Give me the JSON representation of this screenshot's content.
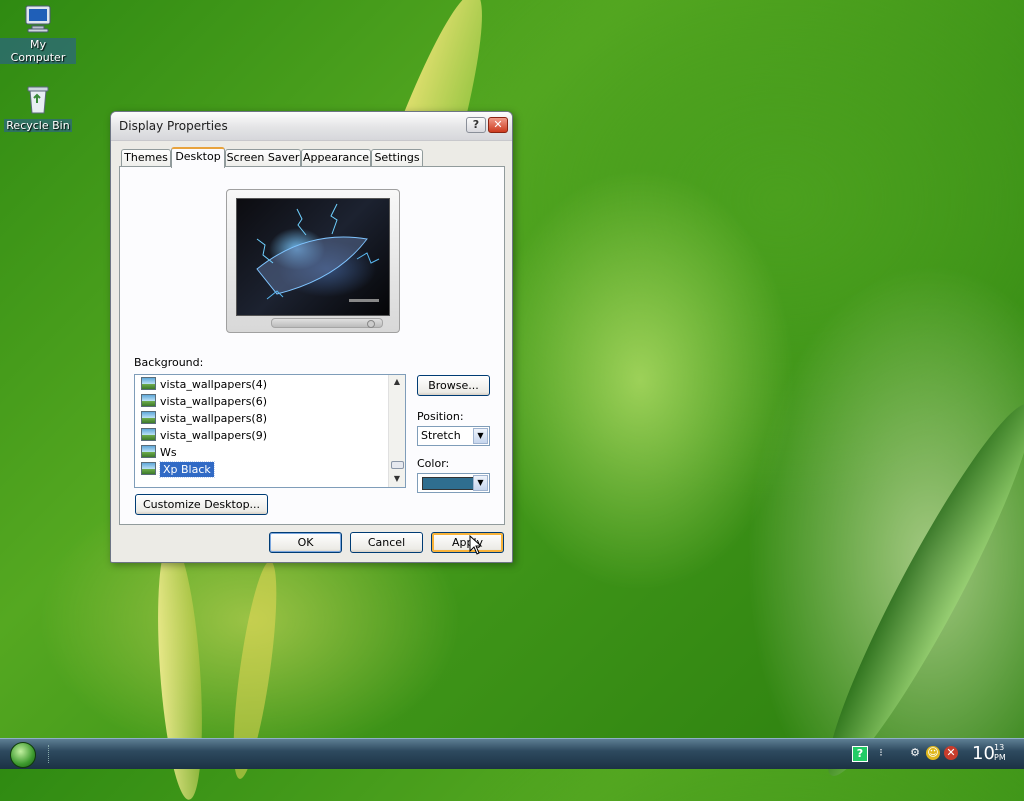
{
  "desktop": {
    "icons": [
      {
        "label": "My Computer"
      },
      {
        "label": "Recycle Bin"
      }
    ]
  },
  "dialog": {
    "title": "Display Properties",
    "help_glyph": "?",
    "close_glyph": "✕",
    "tabs": [
      "Themes",
      "Desktop",
      "Screen Saver",
      "Appearance",
      "Settings"
    ],
    "active_tab": "Desktop",
    "background_label": "Background:",
    "backgrounds": [
      {
        "name": "vista_wallpapers(4)"
      },
      {
        "name": "vista_wallpapers(6)"
      },
      {
        "name": "vista_wallpapers(8)"
      },
      {
        "name": "vista_wallpapers(9)"
      },
      {
        "name": "Ws"
      },
      {
        "name": "Xp Black",
        "selected": true
      }
    ],
    "browse_label": "Browse...",
    "position_label": "Position:",
    "position_value": "Stretch",
    "color_label": "Color:",
    "color_value": "#2f6e8f",
    "customize_label": "Customize Desktop...",
    "ok_label": "OK",
    "cancel_label": "Cancel",
    "apply_label": "Apply"
  },
  "taskbar": {
    "clock_hour": "10",
    "clock_min": "13",
    "clock_ampm": "PM"
  }
}
